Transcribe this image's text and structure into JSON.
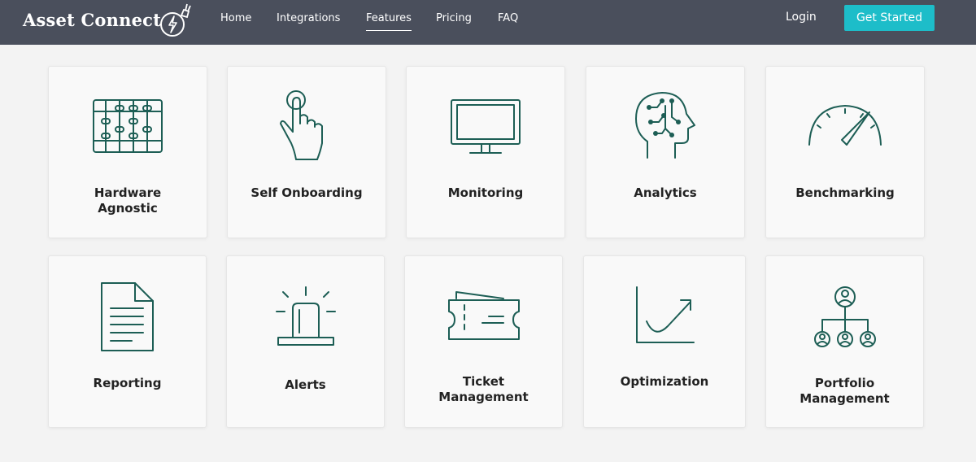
{
  "header": {
    "brand": "Asset Connect",
    "nav": [
      "Home",
      "Integrations",
      "Features",
      "Pricing",
      "FAQ"
    ],
    "active_nav": "Features",
    "login": "Login",
    "cta": "Get Started"
  },
  "features": [
    {
      "label": "Hardware Agnostic",
      "icon": "abacus-icon"
    },
    {
      "label": "Self Onboarding",
      "icon": "tap-hand-icon"
    },
    {
      "label": "Monitoring",
      "icon": "monitor-icon"
    },
    {
      "label": "Analytics",
      "icon": "brain-head-icon"
    },
    {
      "label": "Benchmarking",
      "icon": "speedometer-icon"
    },
    {
      "label": "Reporting",
      "icon": "document-icon"
    },
    {
      "label": "Alerts",
      "icon": "siren-icon"
    },
    {
      "label": "Ticket Management",
      "icon": "ticket-icon"
    },
    {
      "label": "Optimization",
      "icon": "trend-chart-icon"
    },
    {
      "label": "Portfolio Management",
      "icon": "org-chart-icon"
    }
  ],
  "colors": {
    "header_bg": "#4a4f5c",
    "cta_bg": "#1dbdc9",
    "icon_stroke": "#1d5e55",
    "page_bg": "#f3f3f3"
  }
}
